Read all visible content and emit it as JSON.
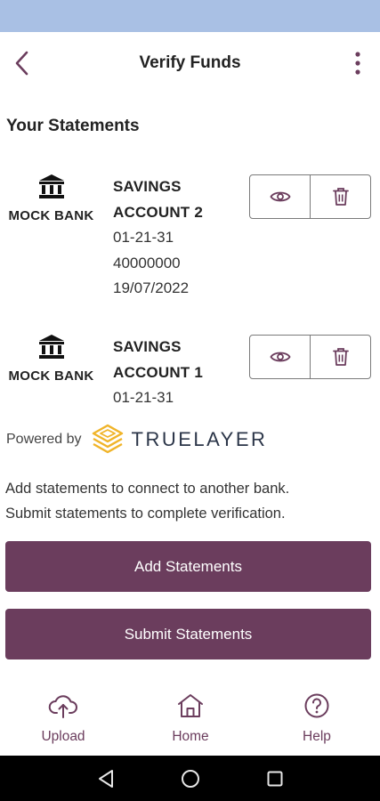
{
  "app_bar": {
    "title": "Verify Funds",
    "back_icon": "chevron-left-icon",
    "menu_icon": "more-vertical-icon"
  },
  "section_title": "Your Statements",
  "statements": [
    {
      "bank_icon": "bank-icon",
      "bank_name": "MOCK BANK",
      "account_name_line1": "SAVINGS",
      "account_name_line2": "ACCOUNT 2",
      "sort_code": "01-21-31",
      "account_number": "40000000",
      "date": "19/07/2022"
    },
    {
      "bank_icon": "bank-icon",
      "bank_name": "MOCK BANK",
      "account_name_line1": "SAVINGS",
      "account_name_line2": "ACCOUNT 1",
      "sort_code": "01-21-31"
    }
  ],
  "powered_by": {
    "label": "Powered by",
    "brand": "TRUELAYER"
  },
  "info_lines": [
    "Add statements to connect to another bank.",
    "Submit statements to complete verification."
  ],
  "buttons": {
    "add": "Add Statements",
    "submit": "Submit Statements"
  },
  "bottom_nav": [
    {
      "label": "Upload",
      "icon": "cloud-upload-icon"
    },
    {
      "label": "Home",
      "icon": "home-icon"
    },
    {
      "label": "Help",
      "icon": "help-circle-icon"
    }
  ],
  "colors": {
    "primary": "#6b3d5d",
    "status_bar": "#a9c0e4",
    "truelayer_gold": "#f0b429"
  }
}
